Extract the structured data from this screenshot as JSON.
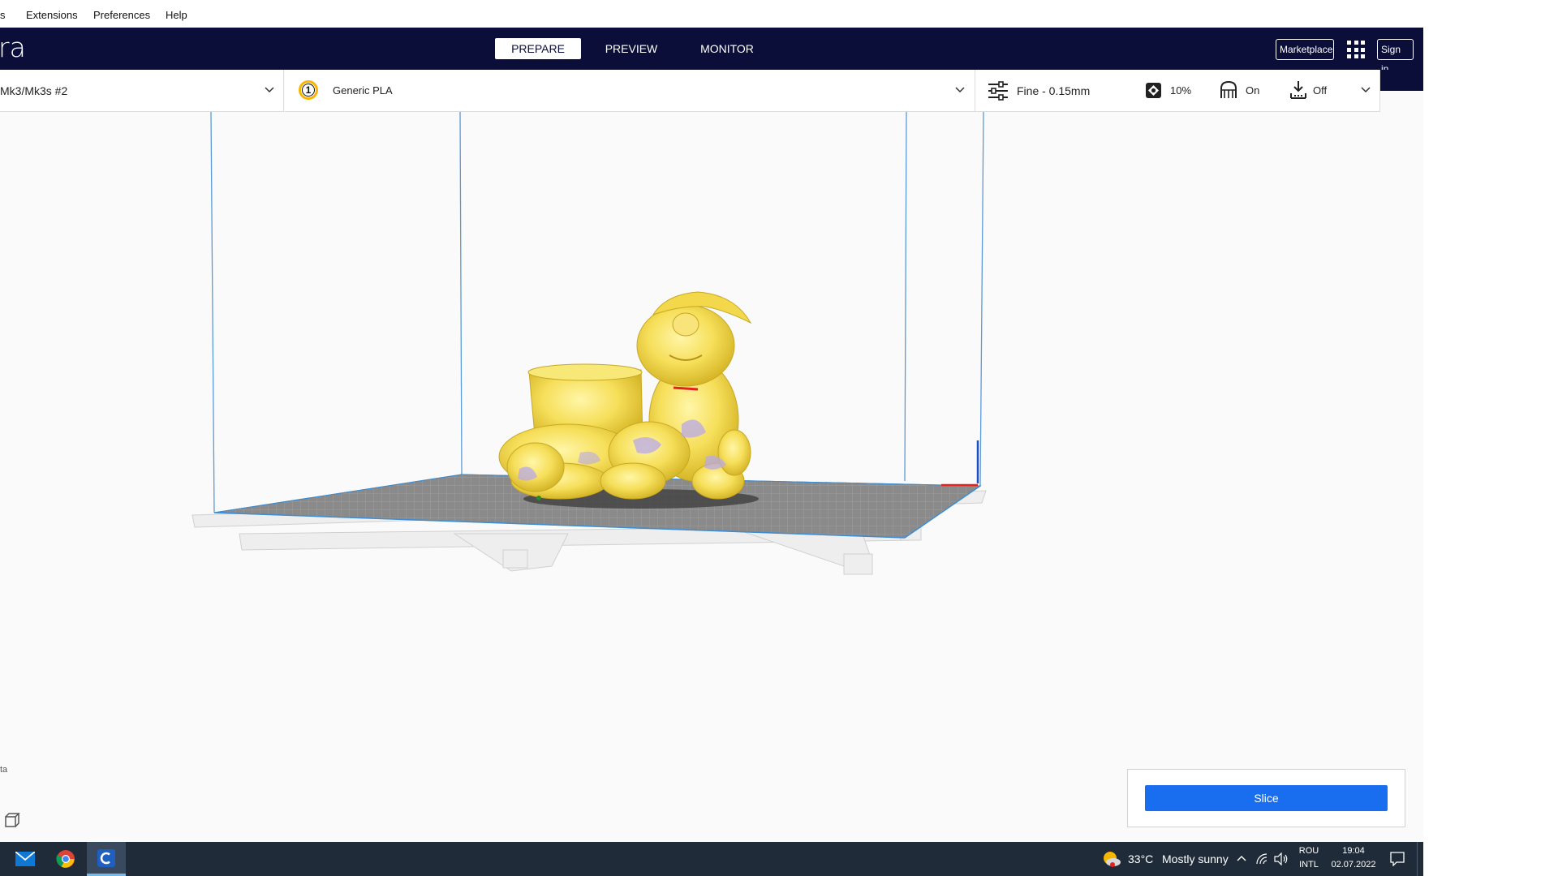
{
  "menu": {
    "items": [
      {
        "label": "s"
      },
      {
        "label": "Extensions"
      },
      {
        "label": "Preferences"
      },
      {
        "label": "Help"
      }
    ]
  },
  "header": {
    "app_title": "ra",
    "tabs": [
      {
        "label": "PREPARE",
        "active": true
      },
      {
        "label": "PREVIEW",
        "active": false
      },
      {
        "label": "MONITOR",
        "active": false
      }
    ],
    "marketplace_label": "Marketplace",
    "apps_icon": "apps-grid-icon",
    "sign_in_label": "Sign in"
  },
  "printer": {
    "name": "Mk3/Mk3s #2"
  },
  "material": {
    "extruder_number": "1",
    "extruder_color": "#f7b600",
    "name": "Generic PLA"
  },
  "print_settings": {
    "profile": "Fine - 0.15mm",
    "infill": "10%",
    "support": "On",
    "adhesion": "Off"
  },
  "viewport": {
    "model_color": "#f5e060",
    "build_volume_color": "#3c8dd6",
    "side_text": "ta"
  },
  "action_panel": {
    "slice_label": "Slice",
    "accent": "#196ef0"
  },
  "taskbar": {
    "apps": [
      {
        "name": "mail-icon"
      },
      {
        "name": "chrome-icon"
      },
      {
        "name": "cura-icon",
        "active": true
      }
    ],
    "weather_temp": "33°C",
    "weather_text": "Mostly sunny",
    "keyboard_lang": "ROU",
    "keyboard_layout": "INTL",
    "time": "19:04",
    "date": "02.07.2022"
  }
}
